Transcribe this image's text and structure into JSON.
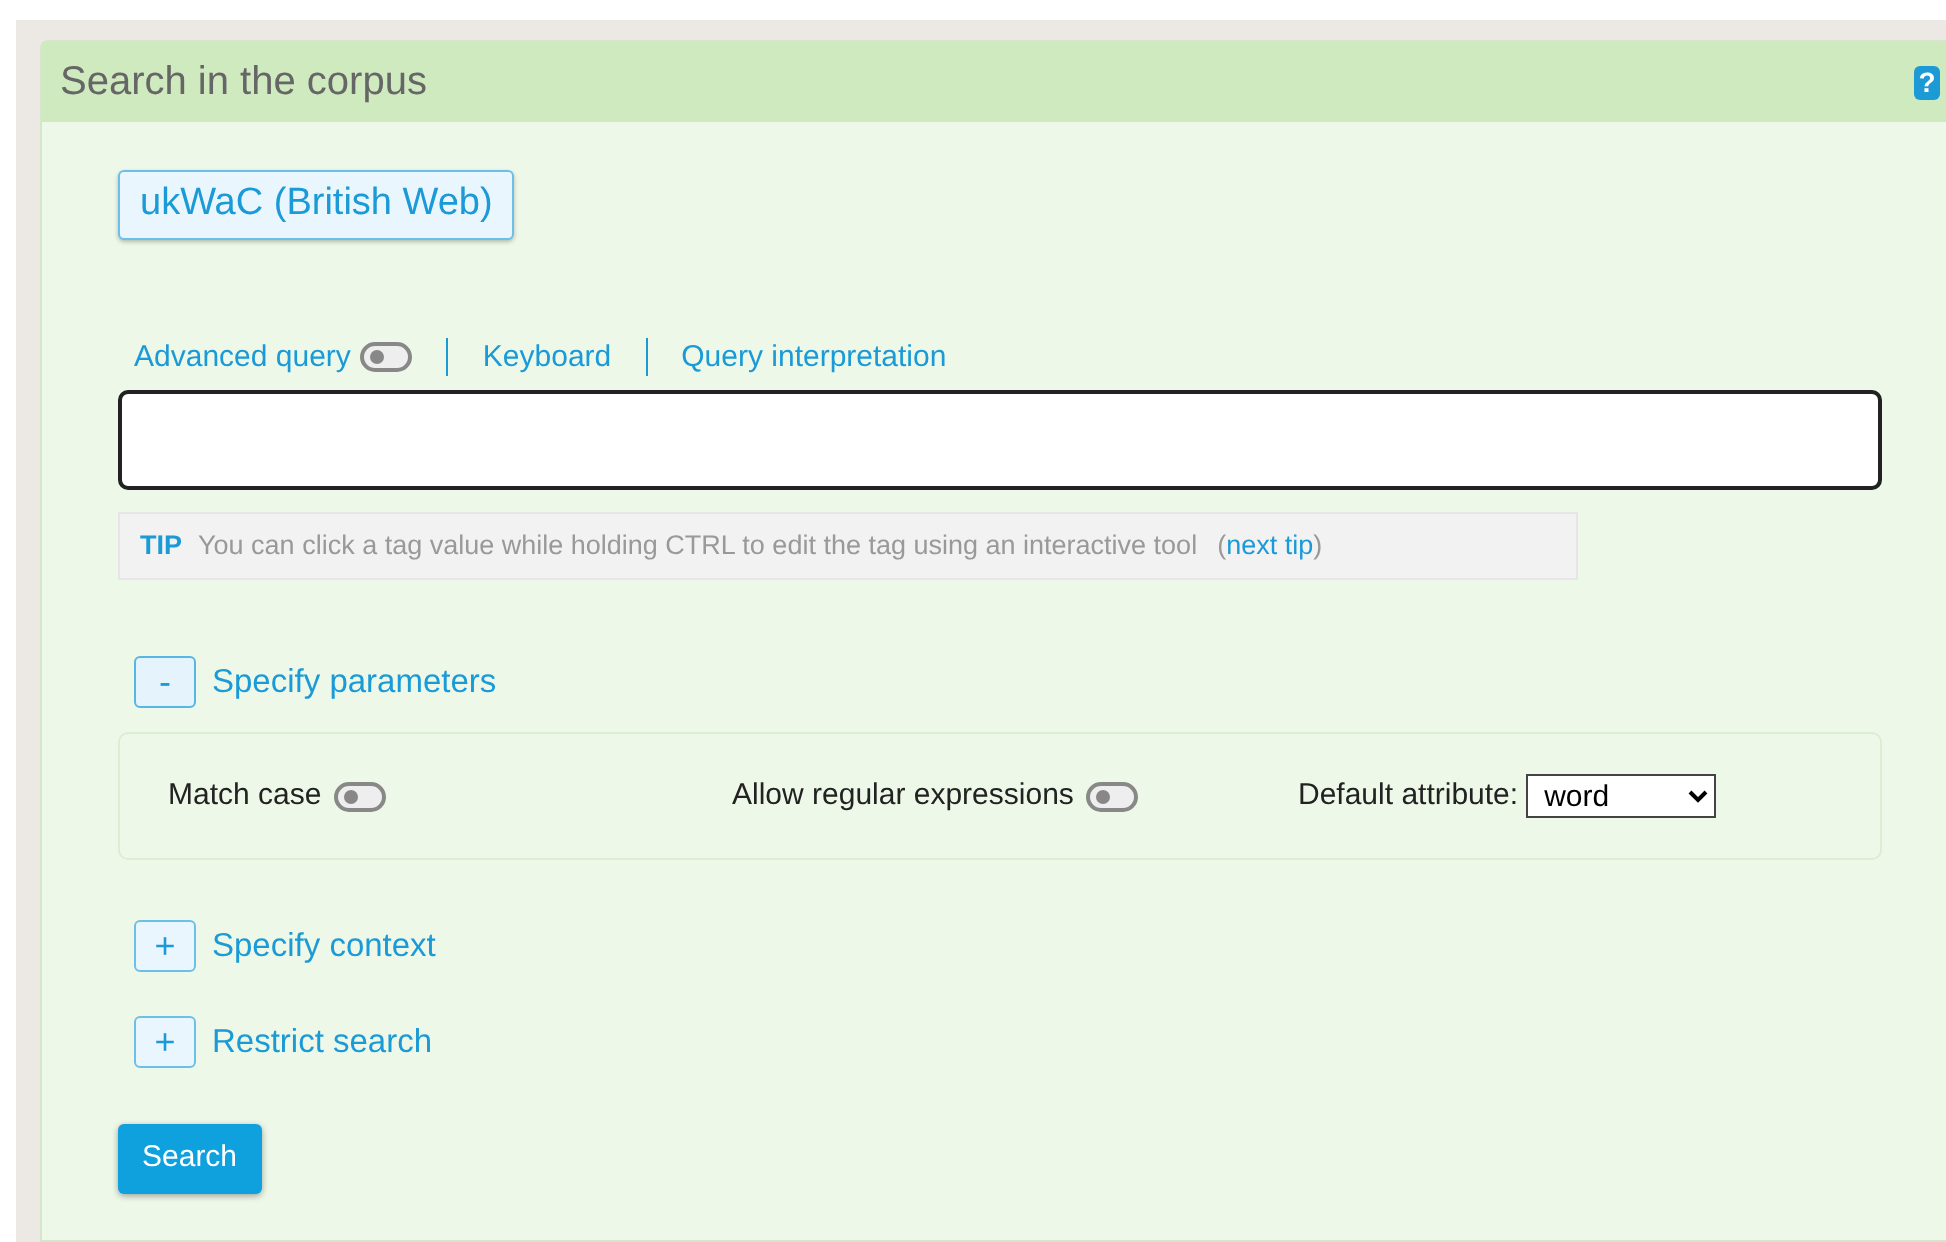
{
  "panel": {
    "title": "Search in the corpus",
    "help_icon": "?"
  },
  "corpus_button": "ukWaC (British Web)",
  "query_links": [
    {
      "label": "Advanced query",
      "kind": "switch",
      "on": false
    },
    {
      "label": "Keyboard",
      "kind": "link"
    },
    {
      "label": "Query interpretation",
      "kind": "link"
    }
  ],
  "tip": {
    "label": "TIP",
    "text": "You can click a tag value while holding CTRL to edit the tag using an interactive tool",
    "open": "(",
    "link": "next tip",
    "close": ")"
  },
  "sections": [
    {
      "symbol": "-",
      "title": "Specify parameters",
      "expanded": true
    },
    {
      "symbol": "+",
      "title": "Specify context",
      "expanded": false
    },
    {
      "symbol": "+",
      "title": "Restrict search",
      "expanded": false
    }
  ],
  "parameters": [
    {
      "kind": "switch",
      "label": "Match case",
      "on": false
    },
    {
      "kind": "switch",
      "label": "Allow regular expressions",
      "on": false
    },
    {
      "kind": "select",
      "label": "Default attribute:",
      "value": "word"
    }
  ],
  "search_button": "Search"
}
